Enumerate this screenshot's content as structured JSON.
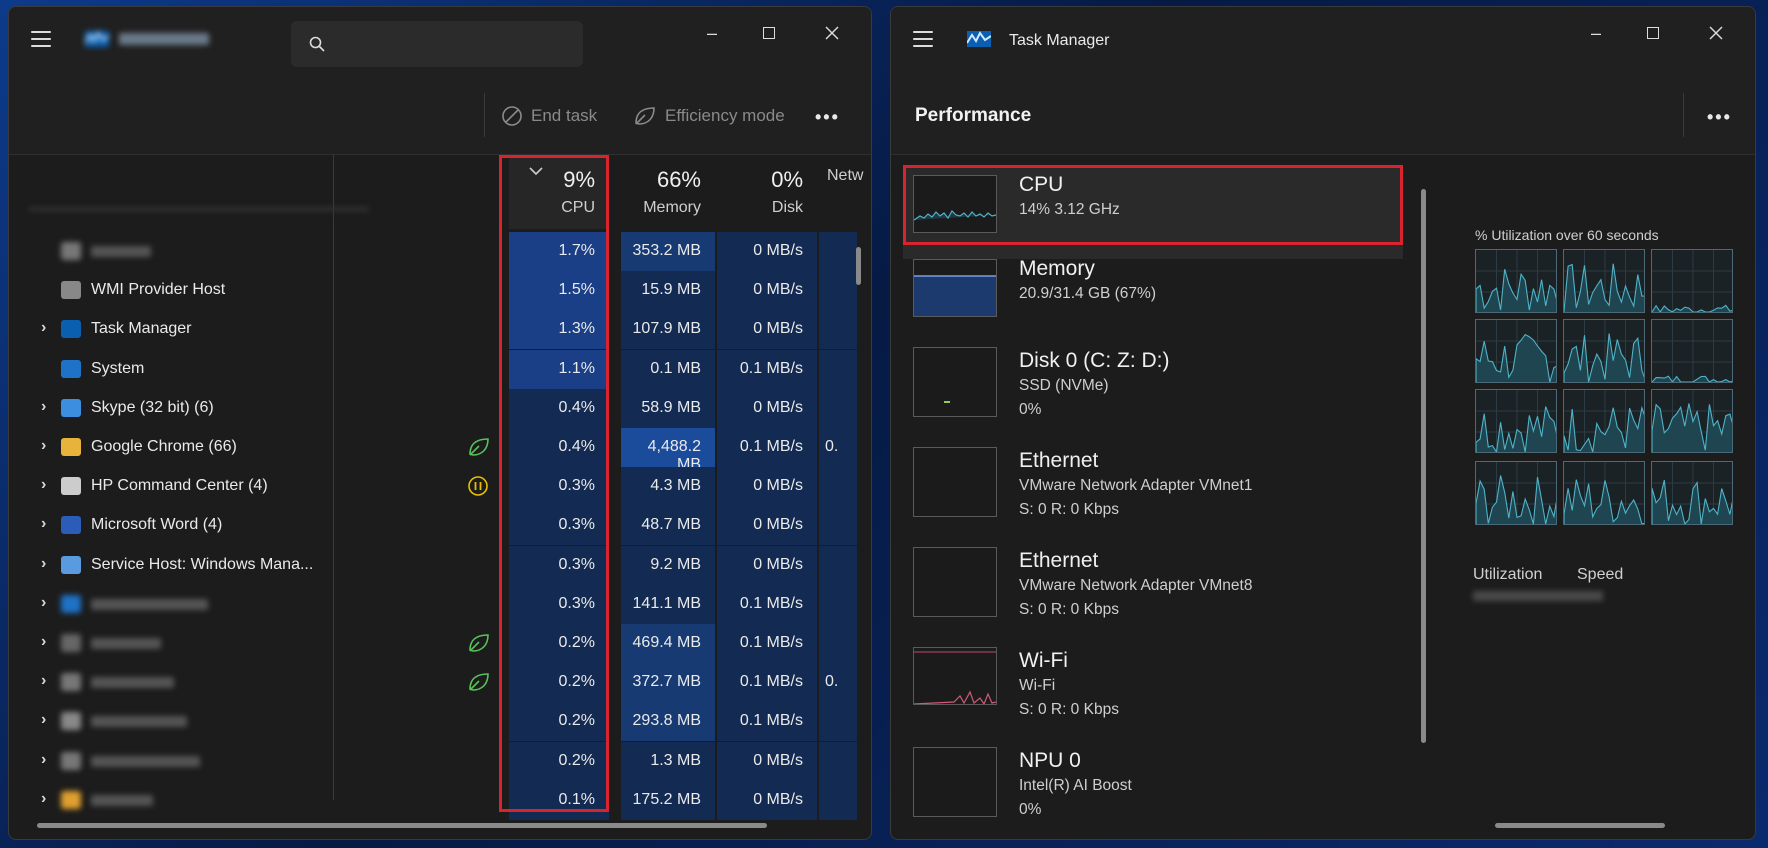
{
  "left_window": {
    "toolbar": {
      "end_task": "End task",
      "efficiency_mode": "Efficiency mode",
      "more": "•••"
    },
    "columns": [
      {
        "pct": "9%",
        "label": "CPU"
      },
      {
        "pct": "66%",
        "label": "Memory"
      },
      {
        "pct": "0%",
        "label": "Disk"
      },
      {
        "pct": "",
        "label": "Netw"
      }
    ],
    "rows": [
      {
        "name": "",
        "cpu": "1.7%",
        "mem": "353.2 MB",
        "disk": "0 MB/s",
        "net": "",
        "expand": false,
        "status": ""
      },
      {
        "name": "WMI Provider Host",
        "cpu": "1.5%",
        "mem": "15.9 MB",
        "disk": "0 MB/s",
        "net": "",
        "expand": false,
        "status": ""
      },
      {
        "name": "Task Manager",
        "cpu": "1.3%",
        "mem": "107.9 MB",
        "disk": "0 MB/s",
        "net": "",
        "expand": true,
        "status": ""
      },
      {
        "name": "System",
        "cpu": "1.1%",
        "mem": "0.1 MB",
        "disk": "0.1 MB/s",
        "net": "",
        "expand": false,
        "status": ""
      },
      {
        "name": "Skype (32 bit) (6)",
        "cpu": "0.4%",
        "mem": "58.9 MB",
        "disk": "0 MB/s",
        "net": "",
        "expand": true,
        "status": ""
      },
      {
        "name": "Google Chrome (66)",
        "cpu": "0.4%",
        "mem": "4,488.2 MB",
        "disk": "0.1 MB/s",
        "net": "0.",
        "expand": true,
        "status": "leaf"
      },
      {
        "name": "HP Command Center (4)",
        "cpu": "0.3%",
        "mem": "4.3 MB",
        "disk": "0 MB/s",
        "net": "",
        "expand": true,
        "status": "pause"
      },
      {
        "name": "Microsoft Word (4)",
        "cpu": "0.3%",
        "mem": "48.7 MB",
        "disk": "0 MB/s",
        "net": "",
        "expand": true,
        "status": ""
      },
      {
        "name": "Service Host: Windows Mana...",
        "cpu": "0.3%",
        "mem": "9.2 MB",
        "disk": "0 MB/s",
        "net": "",
        "expand": true,
        "status": ""
      },
      {
        "name": "",
        "cpu": "0.3%",
        "mem": "141.1 MB",
        "disk": "0.1 MB/s",
        "net": "",
        "expand": true,
        "status": ""
      },
      {
        "name": "",
        "cpu": "0.2%",
        "mem": "469.4 MB",
        "disk": "0.1 MB/s",
        "net": "",
        "expand": true,
        "status": "leaf"
      },
      {
        "name": "",
        "cpu": "0.2%",
        "mem": "372.7 MB",
        "disk": "0.1 MB/s",
        "net": "0.",
        "expand": true,
        "status": "leaf"
      },
      {
        "name": "",
        "cpu": "0.2%",
        "mem": "293.8 MB",
        "disk": "0.1 MB/s",
        "net": "",
        "expand": true,
        "status": ""
      },
      {
        "name": "",
        "cpu": "0.2%",
        "mem": "1.3 MB",
        "disk": "0 MB/s",
        "net": "",
        "expand": true,
        "status": ""
      },
      {
        "name": "",
        "cpu": "0.1%",
        "mem": "175.2 MB",
        "disk": "0 MB/s",
        "net": "",
        "expand": true,
        "status": ""
      }
    ]
  },
  "right_window": {
    "title": "Task Manager",
    "section": "Performance",
    "more": "•••",
    "items": [
      {
        "title": "CPU",
        "sub1": "14%  3.12 GHz",
        "sub2": "",
        "sub3": ""
      },
      {
        "title": "Memory",
        "sub1": "20.9/31.4 GB (67%)",
        "sub2": "",
        "sub3": ""
      },
      {
        "title": "Disk 0 (C: Z: D:)",
        "sub1": "SSD (NVMe)",
        "sub2": "0%",
        "sub3": ""
      },
      {
        "title": "Ethernet",
        "sub1": "VMware Network Adapter VMnet1",
        "sub2": "S: 0  R: 0 Kbps",
        "sub3": ""
      },
      {
        "title": "Ethernet",
        "sub1": "VMware Network Adapter VMnet8",
        "sub2": "S: 0  R: 0 Kbps",
        "sub3": ""
      },
      {
        "title": "Wi-Fi",
        "sub1": "Wi-Fi",
        "sub2": "S: 0  R: 0 Kbps",
        "sub3": ""
      },
      {
        "title": "NPU 0",
        "sub1": "Intel(R) AI Boost",
        "sub2": "0%",
        "sub3": ""
      }
    ],
    "detail": {
      "util_caption": "% Utilization over 60 seconds",
      "utilization": "Utilization",
      "speed": "Speed"
    }
  },
  "colors": {
    "highlight_red": "#d9232e",
    "heat_blue": "#173a73",
    "graph_teal": "#4fb3c8"
  }
}
